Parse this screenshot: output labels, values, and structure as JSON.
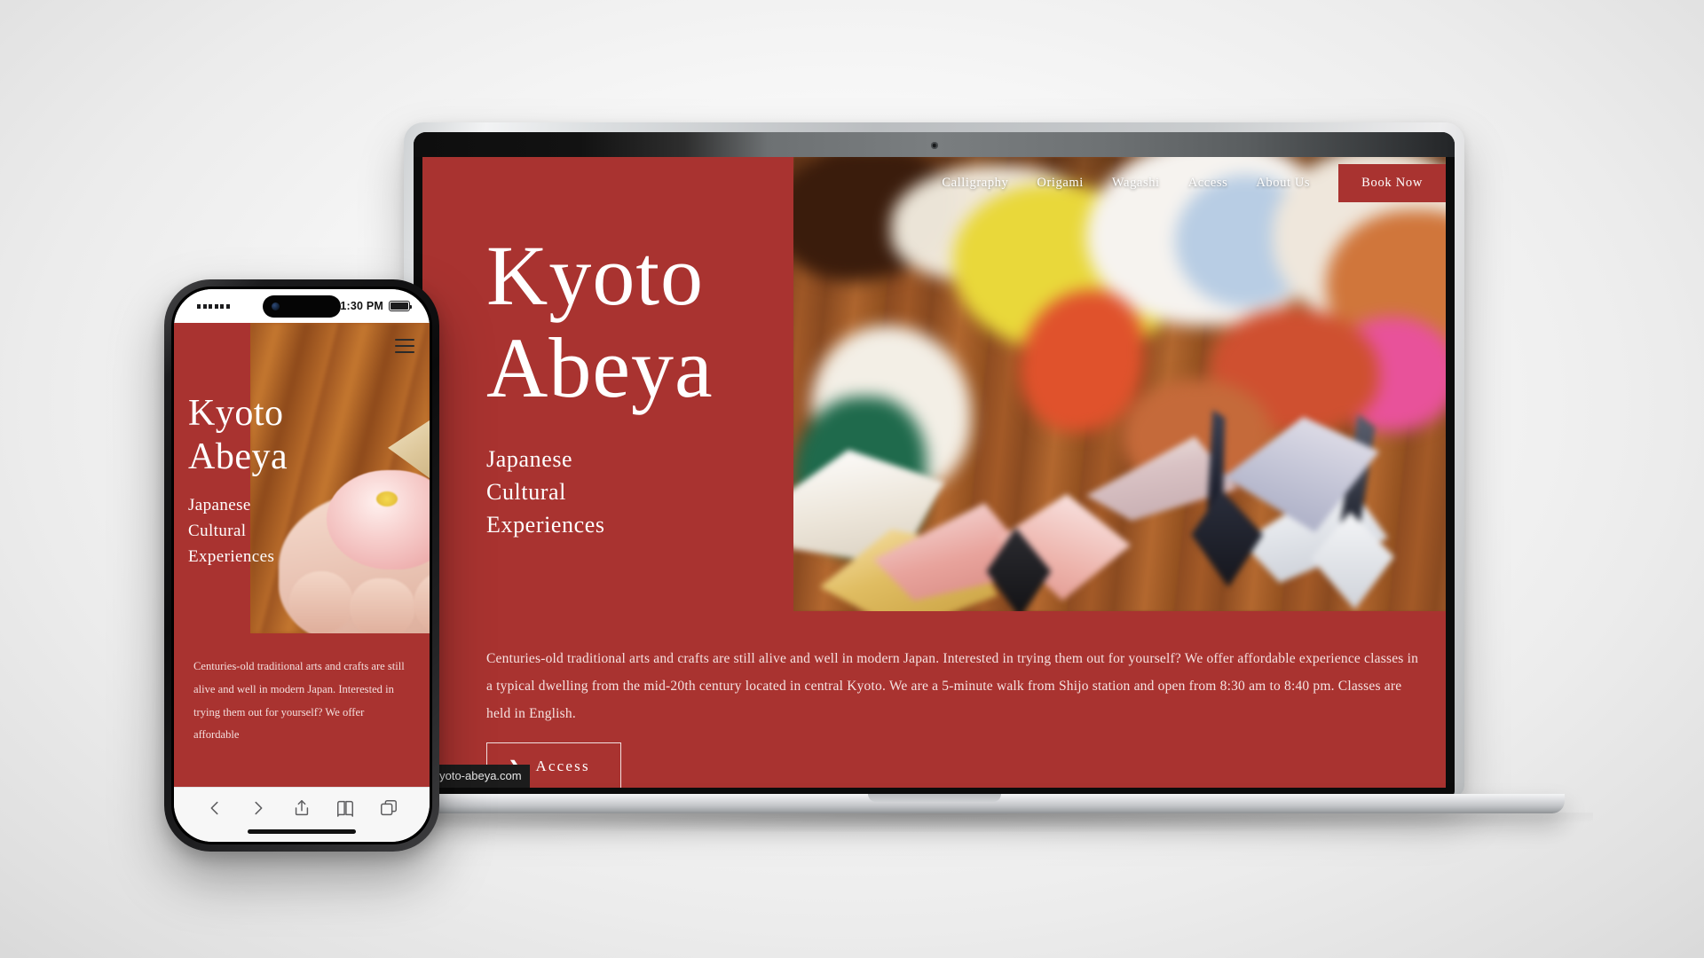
{
  "site": {
    "brand": "Kyoto Abeya",
    "url_tooltip": "/kyoto-abeya.com",
    "accent_red": "#A93330",
    "text_white": "#FFFFFF"
  },
  "desktop": {
    "nav": {
      "links": [
        {
          "label": "Calligraphy",
          "name": "nav-calligraphy"
        },
        {
          "label": "Origami",
          "name": "nav-origami"
        },
        {
          "label": "Wagashi",
          "name": "nav-wagashi"
        },
        {
          "label": "Access",
          "name": "nav-access"
        },
        {
          "label": "About Us",
          "name": "nav-about-us"
        }
      ],
      "cta_label": "Book Now"
    },
    "hero": {
      "title_line1": "Kyoto",
      "title_line2": "Abeya",
      "sub_line1": "Japanese",
      "sub_line2": "Cultural",
      "sub_line3": "Experiences",
      "photo_alt": "origami-cranes-photo"
    },
    "intro_paragraph": "Centuries-old traditional arts and crafts are still alive and well in modern Japan. Interested in trying them out for yourself? We offer affordable experience classes in a typical dwelling from the mid-20th century located in central Kyoto. We are a 5-minute walk from Shijo station and open from 8:30 am to 8:40 pm. Classes are held in English.",
    "access_button": {
      "label": "Access",
      "icon": "chevron-right-icon"
    }
  },
  "phone": {
    "status_bar": {
      "signal": "signal-dots-icon",
      "time": "1:30 PM",
      "battery": "battery-full-icon"
    },
    "menu_icon": "hamburger-menu-icon",
    "hero": {
      "title_line1": "Kyoto",
      "title_line2": "Abeya",
      "sub_line1": "Japanese",
      "sub_line2": "Cultural",
      "sub_line3": "Experiences",
      "photo_alt": "wagashi-sweet-in-hand-photo"
    },
    "intro_paragraph": "Centuries-old traditional arts and crafts are still alive and well in modern Japan. Interested in trying them out for yourself? We offer affordable",
    "toolbar": [
      {
        "name": "back-icon"
      },
      {
        "name": "forward-icon"
      },
      {
        "name": "share-icon"
      },
      {
        "name": "bookmarks-icon"
      },
      {
        "name": "tabs-icon"
      }
    ]
  }
}
